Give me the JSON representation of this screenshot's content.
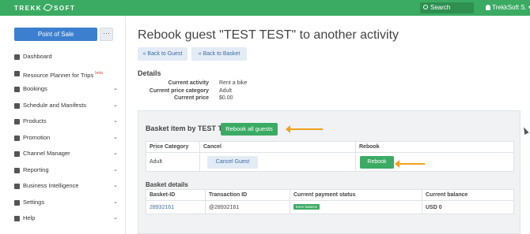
{
  "topbar": {
    "logo_left": "TREKK",
    "logo_right": "SOFT",
    "search_label": "Search",
    "user_label": "TrekkSoft S.",
    "user_caret": "▾",
    "brand_color": "#3bab64"
  },
  "sidebar": {
    "pos_button": "Point of Sale",
    "more_button": "···",
    "items": [
      {
        "label": "Dashboard",
        "icon": "dashboard-icon",
        "chevron": ""
      },
      {
        "label": "Resource Planner for Trips",
        "icon": "road-icon",
        "chevron": "",
        "badge": "beta"
      },
      {
        "label": "Bookings",
        "icon": "tag-icon",
        "chevron": "⌄"
      },
      {
        "label": "Schedule and Manifests",
        "icon": "clock-icon",
        "chevron": "⌄"
      },
      {
        "label": "Products",
        "icon": "list-icon",
        "chevron": "⌄"
      },
      {
        "label": "Promotion",
        "icon": "megaphone-icon",
        "chevron": "⌄"
      },
      {
        "label": "Channel Manager",
        "icon": "network-icon",
        "chevron": "⌄"
      },
      {
        "label": "Reporting",
        "icon": "chart-icon",
        "chevron": "⌄"
      },
      {
        "label": "Business Intelligence",
        "icon": "bars-icon",
        "chevron": "⌄"
      },
      {
        "label": "Settings",
        "icon": "gear-icon",
        "chevron": "⌄"
      },
      {
        "label": "Help",
        "icon": "help-icon",
        "chevron": "⌄"
      }
    ]
  },
  "main": {
    "title": "Rebook guest \"TEST TEST\" to another activity",
    "back_to_guest": "« Back to Guest",
    "back_to_basket": "« Back to Basket",
    "details_heading": "Details",
    "details": [
      {
        "label": "Current activity",
        "value": "Rent a bike"
      },
      {
        "label": "Current price category",
        "value": "Adult"
      },
      {
        "label": "Current price",
        "value": "$0.00"
      }
    ],
    "basket_heading": "Basket item by TEST T",
    "rebook_all": "Rebook all guests",
    "items_table": {
      "headers": [
        "Price Category",
        "Cancel",
        "Rebook"
      ],
      "row": {
        "price_category": "Adult",
        "cancel_label": "Cancel Guest",
        "rebook_label": "Rebook"
      }
    },
    "basket_details_heading": "Basket details",
    "basket_table": {
      "headers": [
        "Basket-ID",
        "Transaction ID",
        "Current payment status",
        "Current balance"
      ],
      "row": {
        "basket_id": "28932161",
        "transaction_id": "@28932161",
        "status": "Even balance",
        "balance": "USD 0"
      }
    }
  }
}
